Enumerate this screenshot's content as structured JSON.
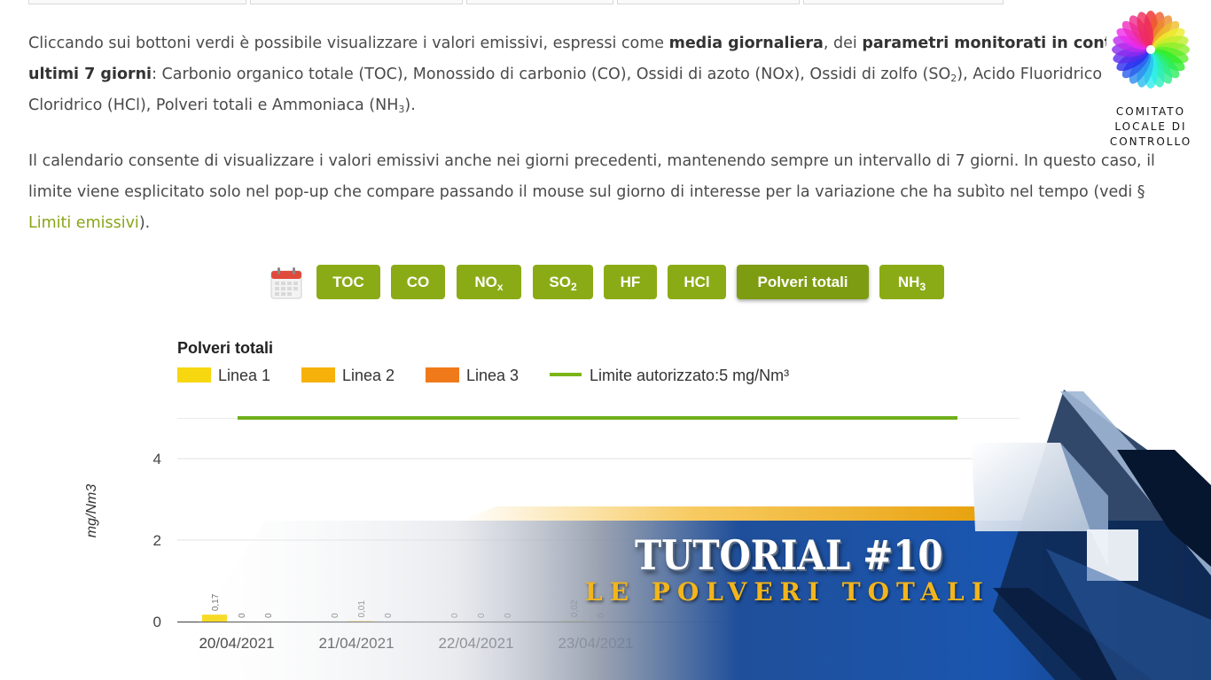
{
  "intro": {
    "line1_a": "Cliccando sui bottoni verdi è possibile visualizzare i valori emissivi, espressi come ",
    "line1_b": "media giornaliera",
    "line1_c": ", dei ",
    "line1_d": "parametri monitorati in continu",
    "line2_a": "ultimi 7 giorni",
    "line2_b": ": Carbonio organico totale (TOC), Monossido di carbonio (CO), Ossidi di azoto (NOx), Ossidi di zolfo (SO",
    "line2_sub": "2",
    "line2_c": "), Acido Fluoridrico (H",
    "line3_a": "Cloridrico (HCl), Polveri totali e Ammoniaca (NH",
    "line3_sub": "3",
    "line3_b": ")."
  },
  "calendar_note": {
    "line1": "Il calendario consente di visualizzare i valori emissivi anche nei giorni precedenti, mantenendo sempre un intervallo di 7 giorni. In questo caso, il",
    "line2": "limite viene esplicitato solo nel pop-up che compare passando il mouse sul giorno di interesse per la variazione che ha subìto nel tempo (vedi §",
    "link": "Limiti emissivi",
    "line3_end": ")."
  },
  "logo": {
    "line1": "COMITATO",
    "line2": "LOCALE DI",
    "line3": "CONTROLLO"
  },
  "buttons": [
    {
      "label": "TOC",
      "sub": ""
    },
    {
      "label": "CO",
      "sub": ""
    },
    {
      "label": "NO",
      "sub": "x"
    },
    {
      "label": "SO",
      "sub": "2"
    },
    {
      "label": "HF",
      "sub": ""
    },
    {
      "label": "HCl",
      "sub": ""
    },
    {
      "label": "Polveri totali",
      "sub": ""
    },
    {
      "label": "NH",
      "sub": "3"
    }
  ],
  "active_button": "Polveri totali",
  "colors": {
    "button_green": "#8bab16",
    "link_green": "#8aa51a",
    "linea1": "#f7d70f",
    "linea2": "#f6b10a",
    "linea3": "#f07a1a",
    "limit": "#6fb01c"
  },
  "chart_data": {
    "type": "bar",
    "title": "Polveri totali",
    "ylabel": "mg/Nm3",
    "ylim": [
      0,
      5
    ],
    "yticks": [
      "0",
      "2",
      "4"
    ],
    "categories": [
      "20/04/2021",
      "21/04/2021",
      "22/04/2021",
      "23/04/2021"
    ],
    "series": [
      {
        "name": "Linea 1",
        "values": [
          0.17,
          0,
          0,
          0.02
        ],
        "labels": [
          "0,17",
          "0",
          "0",
          "0,02"
        ]
      },
      {
        "name": "Linea 2",
        "values": [
          0,
          0.01,
          0,
          0
        ],
        "labels": [
          "0",
          "0,01",
          "0",
          "0"
        ]
      },
      {
        "name": "Linea 3",
        "values": [
          0,
          0,
          0,
          0
        ],
        "labels": [
          "0",
          "0",
          "0",
          ""
        ]
      }
    ],
    "limit": {
      "name": "Limite autorizzato:5 mg/Nm³",
      "value": 5
    },
    "grid": true,
    "legend": "top-left"
  },
  "overlay": {
    "title": "TUTORIAL #10",
    "subtitle": "LE POLVERI TOTALI"
  }
}
